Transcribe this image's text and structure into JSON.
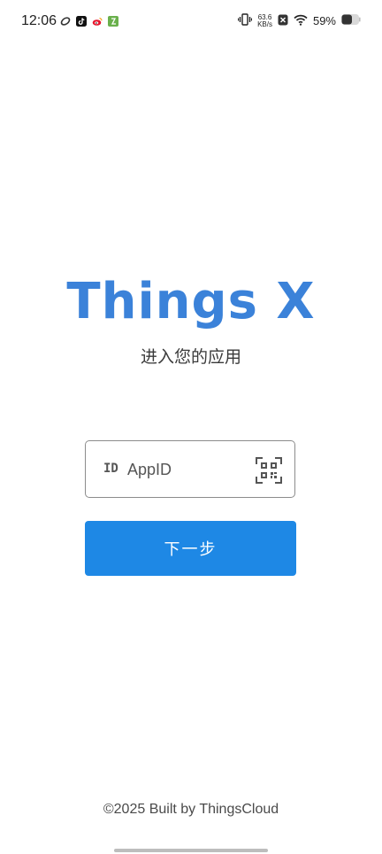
{
  "status_bar": {
    "time": "12:06",
    "net_speed_value": "63.6",
    "net_speed_unit": "KB/s",
    "battery": "59%"
  },
  "brand": {
    "title": "Things X",
    "subtitle": "进入您的应用",
    "accent_color": "#3b82d9"
  },
  "form": {
    "id_prefix": "ID",
    "appid_placeholder": "AppID",
    "appid_value": "",
    "next_label": "下一步",
    "button_color": "#1e88e5"
  },
  "footer": {
    "text": "©2025 Built by ThingsCloud"
  },
  "icons": {
    "status_left": [
      "link-icon",
      "tiktok-icon",
      "weibo-icon",
      "app-icon"
    ],
    "status_right": [
      "vibrate-icon",
      "close-box-icon",
      "wifi-icon",
      "battery-icon"
    ],
    "scan": "qr-scan-icon"
  }
}
